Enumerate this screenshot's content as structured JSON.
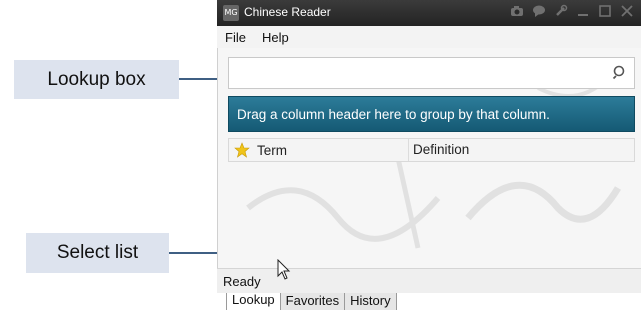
{
  "window": {
    "title": "Chinese Reader",
    "app_icon_text": "MG",
    "titlebar_icons": [
      "camera-icon",
      "chat-icon",
      "wrench-icon",
      "minimize-icon",
      "maximize-icon",
      "close-icon"
    ]
  },
  "menu": {
    "items": [
      "File",
      "Help"
    ]
  },
  "search": {
    "value": "",
    "icon": "search-icon"
  },
  "grid": {
    "group_hint": "Drag a column header here to group by that column.",
    "columns": [
      "Term",
      "Definition"
    ],
    "star_icon": "star-icon",
    "rows": []
  },
  "tabs": [
    "Lookup",
    "Favorites",
    "History"
  ],
  "status": {
    "text": "Ready"
  },
  "callouts": {
    "lookup_box": "Lookup box",
    "select_list": "Select list"
  },
  "colors": {
    "group_header_bg": "#1f6f8b",
    "titlebar_bg": "#2c2c2c",
    "callout_bg": "#dde3ee",
    "callout_line": "#3f5f83",
    "star": "#f0c419"
  }
}
